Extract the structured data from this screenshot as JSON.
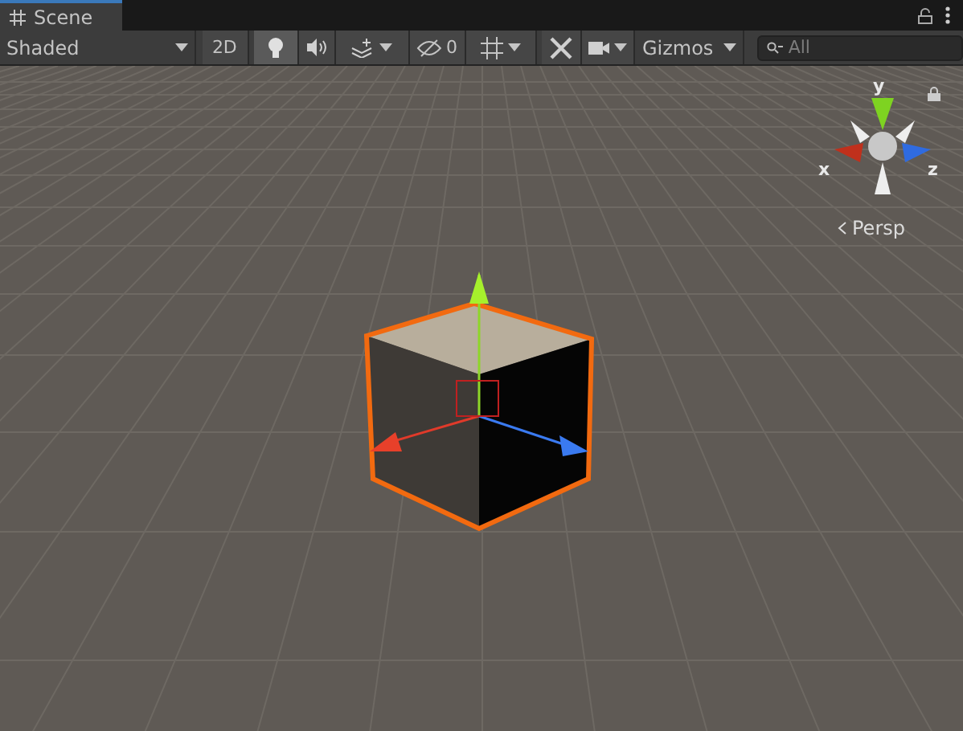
{
  "tabs": [
    {
      "label": "Scene",
      "selected": true
    }
  ],
  "toolbar": {
    "shading": "Shaded",
    "toggles": [
      {
        "kind": "mode2d",
        "label": "2D",
        "on": false
      },
      {
        "kind": "light",
        "on": true
      },
      {
        "kind": "audio",
        "on": false
      },
      {
        "kind": "effects",
        "on": false
      },
      {
        "kind": "hidden",
        "label": "0",
        "on": false
      },
      {
        "kind": "grid",
        "on": false
      },
      {
        "kind": "tools",
        "on": false
      },
      {
        "kind": "camera",
        "on": false
      }
    ],
    "gizmos": "Gizmos",
    "search": {
      "placeholder": "All"
    }
  },
  "orientation_gizmo": {
    "axes": [
      {
        "kind": "y",
        "label": "y"
      },
      {
        "kind": "x",
        "label": "x"
      },
      {
        "kind": "z",
        "label": "z"
      }
    ],
    "projection": "Persp"
  }
}
